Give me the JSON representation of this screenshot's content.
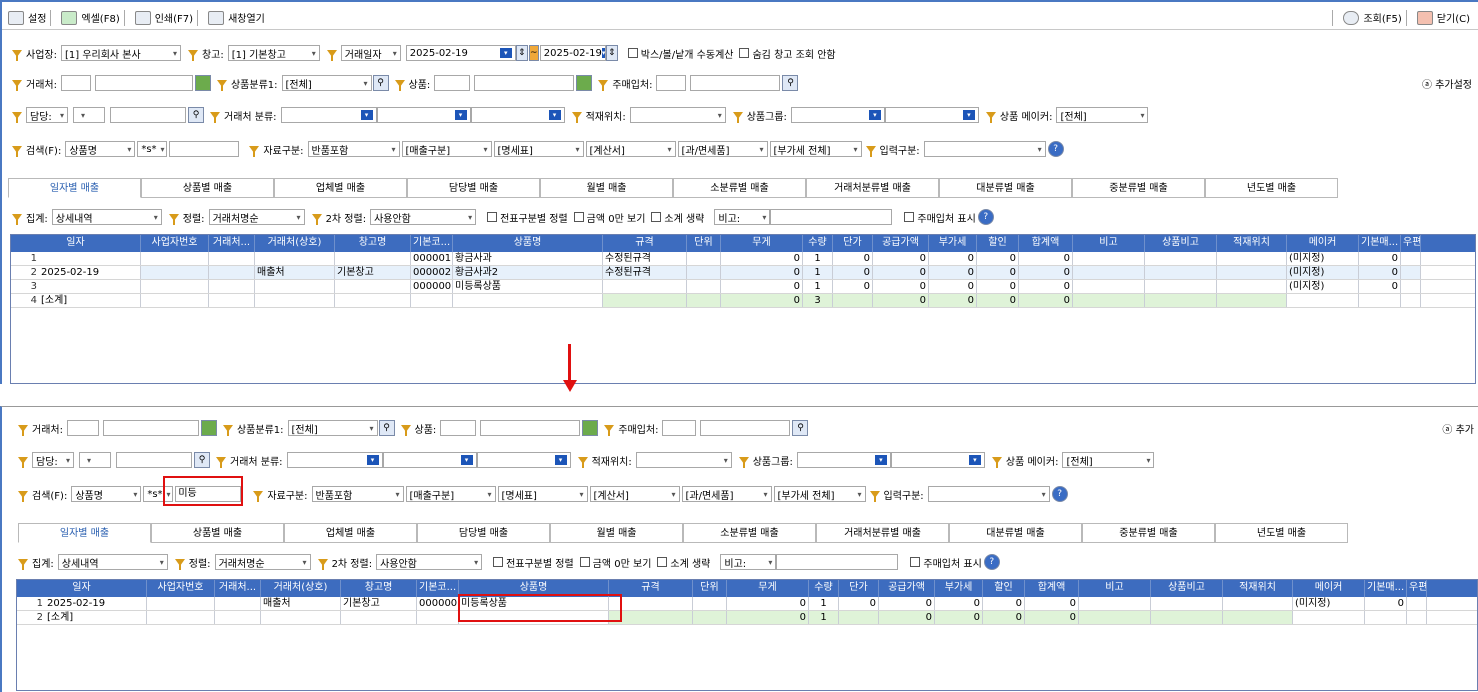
{
  "toolbar": {
    "settings": "설정",
    "excel": "엑셀(F8)",
    "print": "인쇄(F7)",
    "new_window": "새창열기",
    "search": "조회(F5)",
    "close": "닫기(C)"
  },
  "filters": {
    "business_label": "사업장:",
    "business_value": "[1] 우리회사 본사",
    "warehouse_label": "창고:",
    "warehouse_value": "[1] 기본창고",
    "date_type": "거래일자",
    "date_from": "2025-02-19",
    "date_to": "2025-02-19",
    "box_calc": "박스/볼/낱개 수동계산",
    "hide_wh": "숨김 창고 조회 안함",
    "client_label": "거래처:",
    "category1_label": "상품분류1:",
    "category1_value": "[전체]",
    "product_label": "상품:",
    "main_buyer_label": "주매입처:",
    "more_settings": "추가설정",
    "more_settings_short": "추가",
    "manager_label": "담당:",
    "client_cat_label": "거래처 분류:",
    "location_label": "적재위치:",
    "product_group_label": "상품그룹:",
    "maker_label": "상품 메이커:",
    "maker_value": "[전체]",
    "search_label": "검색(F):",
    "search_field": "상품명",
    "search_op": "*s*",
    "search_text_after": "미등",
    "data_type_label": "자료구분:",
    "data_type_value": "반품포함",
    "sales_type": "[매출구분]",
    "statement": "[명세표]",
    "invoice": "[계산서]",
    "tax_type": "[과/면세품]",
    "vat": "[부가세 전체]",
    "input_type_label": "입력구분:"
  },
  "tabs": [
    "일자별 매출",
    "상품별 매출",
    "업체별 매출",
    "담당별 매출",
    "월별 매출",
    "소분류별 매출",
    "거래처분류별 매출",
    "대분류별 매출",
    "중분류별 매출",
    "년도별 매출"
  ],
  "options": {
    "agg_label": "집계:",
    "agg_value": "상세내역",
    "sort_label": "정렬:",
    "sort_value": "거래처명순",
    "sort2_label": "2차 정렬:",
    "sort2_value": "사용안함",
    "opt1": "전표구분별 정렬",
    "opt2": "금액 0만 보기",
    "opt3": "소계 생략",
    "note_label": "비고:",
    "show_buyer": "주매입처 표시"
  },
  "columns": [
    "일자",
    "사업자번호",
    "거래처...",
    "거래처(상호)",
    "창고명",
    "기본코...",
    "상품명",
    "규격",
    "단위",
    "무게",
    "수량",
    "단가",
    "공급가액",
    "부가세",
    "할인",
    "합계액",
    "비고",
    "상품비고",
    "적재위치",
    "메이커",
    "기본매...",
    "우편"
  ],
  "top_rows": [
    {
      "no": "1",
      "date": "",
      "biz": "",
      "cli": "",
      "cname": "",
      "wh": "",
      "code": "000001",
      "prod": "황금사과",
      "spec": "수정된규격",
      "unit": "",
      "wt": "0",
      "qty": "1",
      "price": "0",
      "supply": "0",
      "vat": "0",
      "disc": "0",
      "total": "0",
      "maker": "(미지정)",
      "base": "0"
    },
    {
      "no": "2",
      "date": "2025-02-19",
      "biz": "",
      "cli": "",
      "cname": "매출처",
      "wh": "기본창고",
      "code": "000002",
      "prod": "황금사과2",
      "spec": "수정된규격",
      "unit": "",
      "wt": "0",
      "qty": "1",
      "price": "0",
      "supply": "0",
      "vat": "0",
      "disc": "0",
      "total": "0",
      "maker": "(미지정)",
      "base": "0"
    },
    {
      "no": "3",
      "date": "",
      "biz": "",
      "cli": "",
      "cname": "",
      "wh": "",
      "code": "000000",
      "prod": "미등록상품",
      "spec": "",
      "unit": "",
      "wt": "0",
      "qty": "1",
      "price": "0",
      "supply": "0",
      "vat": "0",
      "disc": "0",
      "total": "0",
      "maker": "(미지정)",
      "base": "0"
    },
    {
      "no": "4",
      "date": "[소계]",
      "biz": "",
      "cli": "",
      "cname": "",
      "wh": "",
      "code": "",
      "prod": "",
      "spec": "",
      "unit": "",
      "wt": "0",
      "qty": "3",
      "price": "",
      "supply": "0",
      "vat": "0",
      "disc": "0",
      "total": "0",
      "maker": "",
      "base": ""
    }
  ],
  "bottom_rows": [
    {
      "no": "1",
      "date": "2025-02-19",
      "biz": "",
      "cli": "",
      "cname": "매출처",
      "wh": "기본창고",
      "code": "000000",
      "prod": "미등록상품",
      "spec": "",
      "unit": "",
      "wt": "0",
      "qty": "1",
      "price": "0",
      "supply": "0",
      "vat": "0",
      "disc": "0",
      "total": "0",
      "maker": "(미지정)",
      "base": "0"
    },
    {
      "no": "2",
      "date": "[소계]",
      "biz": "",
      "cli": "",
      "cname": "",
      "wh": "",
      "code": "",
      "prod": "",
      "spec": "",
      "unit": "",
      "wt": "0",
      "qty": "1",
      "price": "",
      "supply": "0",
      "vat": "0",
      "disc": "0",
      "total": "0",
      "maker": "",
      "base": ""
    }
  ],
  "colors": {
    "header": "#3d6cbf",
    "highlight": "#e01010",
    "arrow": "#e01010"
  }
}
